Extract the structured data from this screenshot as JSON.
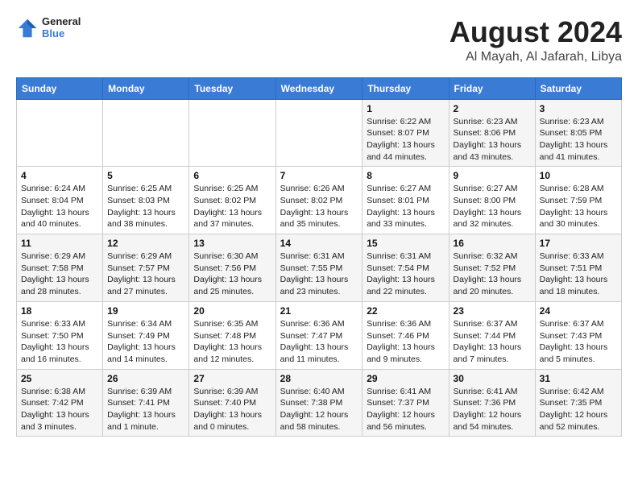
{
  "logo": {
    "line1": "General",
    "line2": "Blue"
  },
  "title": "August 2024",
  "location": "Al Mayah, Al Jafarah, Libya",
  "weekdays": [
    "Sunday",
    "Monday",
    "Tuesday",
    "Wednesday",
    "Thursday",
    "Friday",
    "Saturday"
  ],
  "weeks": [
    [
      {
        "day": "",
        "info": ""
      },
      {
        "day": "",
        "info": ""
      },
      {
        "day": "",
        "info": ""
      },
      {
        "day": "",
        "info": ""
      },
      {
        "day": "1",
        "info": "Sunrise: 6:22 AM\nSunset: 8:07 PM\nDaylight: 13 hours\nand 44 minutes."
      },
      {
        "day": "2",
        "info": "Sunrise: 6:23 AM\nSunset: 8:06 PM\nDaylight: 13 hours\nand 43 minutes."
      },
      {
        "day": "3",
        "info": "Sunrise: 6:23 AM\nSunset: 8:05 PM\nDaylight: 13 hours\nand 41 minutes."
      }
    ],
    [
      {
        "day": "4",
        "info": "Sunrise: 6:24 AM\nSunset: 8:04 PM\nDaylight: 13 hours\nand 40 minutes."
      },
      {
        "day": "5",
        "info": "Sunrise: 6:25 AM\nSunset: 8:03 PM\nDaylight: 13 hours\nand 38 minutes."
      },
      {
        "day": "6",
        "info": "Sunrise: 6:25 AM\nSunset: 8:02 PM\nDaylight: 13 hours\nand 37 minutes."
      },
      {
        "day": "7",
        "info": "Sunrise: 6:26 AM\nSunset: 8:02 PM\nDaylight: 13 hours\nand 35 minutes."
      },
      {
        "day": "8",
        "info": "Sunrise: 6:27 AM\nSunset: 8:01 PM\nDaylight: 13 hours\nand 33 minutes."
      },
      {
        "day": "9",
        "info": "Sunrise: 6:27 AM\nSunset: 8:00 PM\nDaylight: 13 hours\nand 32 minutes."
      },
      {
        "day": "10",
        "info": "Sunrise: 6:28 AM\nSunset: 7:59 PM\nDaylight: 13 hours\nand 30 minutes."
      }
    ],
    [
      {
        "day": "11",
        "info": "Sunrise: 6:29 AM\nSunset: 7:58 PM\nDaylight: 13 hours\nand 28 minutes."
      },
      {
        "day": "12",
        "info": "Sunrise: 6:29 AM\nSunset: 7:57 PM\nDaylight: 13 hours\nand 27 minutes."
      },
      {
        "day": "13",
        "info": "Sunrise: 6:30 AM\nSunset: 7:56 PM\nDaylight: 13 hours\nand 25 minutes."
      },
      {
        "day": "14",
        "info": "Sunrise: 6:31 AM\nSunset: 7:55 PM\nDaylight: 13 hours\nand 23 minutes."
      },
      {
        "day": "15",
        "info": "Sunrise: 6:31 AM\nSunset: 7:54 PM\nDaylight: 13 hours\nand 22 minutes."
      },
      {
        "day": "16",
        "info": "Sunrise: 6:32 AM\nSunset: 7:52 PM\nDaylight: 13 hours\nand 20 minutes."
      },
      {
        "day": "17",
        "info": "Sunrise: 6:33 AM\nSunset: 7:51 PM\nDaylight: 13 hours\nand 18 minutes."
      }
    ],
    [
      {
        "day": "18",
        "info": "Sunrise: 6:33 AM\nSunset: 7:50 PM\nDaylight: 13 hours\nand 16 minutes."
      },
      {
        "day": "19",
        "info": "Sunrise: 6:34 AM\nSunset: 7:49 PM\nDaylight: 13 hours\nand 14 minutes."
      },
      {
        "day": "20",
        "info": "Sunrise: 6:35 AM\nSunset: 7:48 PM\nDaylight: 13 hours\nand 12 minutes."
      },
      {
        "day": "21",
        "info": "Sunrise: 6:36 AM\nSunset: 7:47 PM\nDaylight: 13 hours\nand 11 minutes."
      },
      {
        "day": "22",
        "info": "Sunrise: 6:36 AM\nSunset: 7:46 PM\nDaylight: 13 hours\nand 9 minutes."
      },
      {
        "day": "23",
        "info": "Sunrise: 6:37 AM\nSunset: 7:44 PM\nDaylight: 13 hours\nand 7 minutes."
      },
      {
        "day": "24",
        "info": "Sunrise: 6:37 AM\nSunset: 7:43 PM\nDaylight: 13 hours\nand 5 minutes."
      }
    ],
    [
      {
        "day": "25",
        "info": "Sunrise: 6:38 AM\nSunset: 7:42 PM\nDaylight: 13 hours\nand 3 minutes."
      },
      {
        "day": "26",
        "info": "Sunrise: 6:39 AM\nSunset: 7:41 PM\nDaylight: 13 hours\nand 1 minute."
      },
      {
        "day": "27",
        "info": "Sunrise: 6:39 AM\nSunset: 7:40 PM\nDaylight: 13 hours\nand 0 minutes."
      },
      {
        "day": "28",
        "info": "Sunrise: 6:40 AM\nSunset: 7:38 PM\nDaylight: 12 hours\nand 58 minutes."
      },
      {
        "day": "29",
        "info": "Sunrise: 6:41 AM\nSunset: 7:37 PM\nDaylight: 12 hours\nand 56 minutes."
      },
      {
        "day": "30",
        "info": "Sunrise: 6:41 AM\nSunset: 7:36 PM\nDaylight: 12 hours\nand 54 minutes."
      },
      {
        "day": "31",
        "info": "Sunrise: 6:42 AM\nSunset: 7:35 PM\nDaylight: 12 hours\nand 52 minutes."
      }
    ]
  ]
}
